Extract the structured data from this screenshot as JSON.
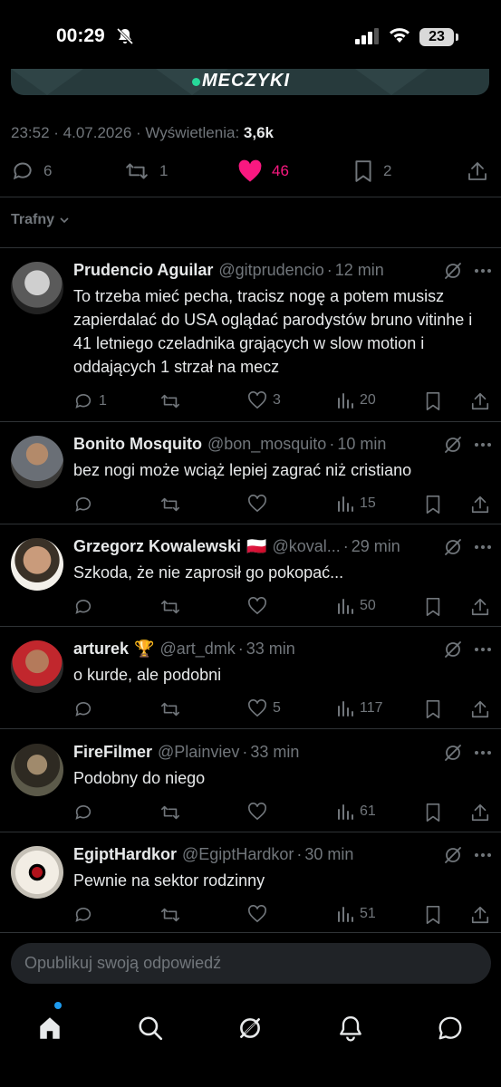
{
  "status": {
    "time": "00:29",
    "battery": "23"
  },
  "media": {
    "logo_text": "MECZYKI",
    "accent_color": "#27d99a"
  },
  "tweet": {
    "time": "23:52",
    "date": "4.07.2026",
    "views_label": "Wyświetlenia:",
    "views": "3,6k",
    "replies": "6",
    "reposts": "1",
    "likes": "46",
    "bookmarks": "2",
    "like_color": "#f91880"
  },
  "sort_label": "Trafny",
  "replies": [
    {
      "name": "Prudencio Aguilar",
      "handle": "@gitprudencio",
      "time": "12 min",
      "text": "To trzeba mieć pecha, tracisz nogę a potem musisz zapierdalać do USA oglądać parodystów bruno vitinhe i 41 letniego czeladnika grających w slow motion i oddających 1 strzał na mecz",
      "replies": "1",
      "reposts": "",
      "likes": "3",
      "views": "20"
    },
    {
      "name": "Bonito Mosquito",
      "handle": "@bon_mosquito",
      "time": "10 min",
      "text": "bez nogi może wciąż lepiej zagrać niż cristiano",
      "replies": "",
      "reposts": "",
      "likes": "",
      "views": "15"
    },
    {
      "name": "Grzegorz Kowalewski",
      "badge": "🇵🇱",
      "handle": "@koval...",
      "time": "29 min",
      "text": "Szkoda, że nie zaprosił go pokopać...",
      "replies": "",
      "reposts": "",
      "likes": "",
      "views": "50"
    },
    {
      "name": "arturek",
      "badge": "🏆",
      "handle": "@art_dmk",
      "time": "33 min",
      "text": "o kurde, ale podobni",
      "replies": "",
      "reposts": "",
      "likes": "5",
      "views": "117"
    },
    {
      "name": "FireFilmer",
      "handle": "@Plainviev",
      "time": "33 min",
      "text": "Podobny do niego",
      "replies": "",
      "reposts": "",
      "likes": "",
      "views": "61"
    },
    {
      "name": "EgiptHardkor",
      "handle": "@EgiptHardkor",
      "time": "30 min",
      "text": "Pewnie na sektor rodzinny",
      "replies": "",
      "reposts": "",
      "likes": "",
      "views": "51"
    }
  ],
  "compose": {
    "placeholder": "Opublikuj swoją odpowiedź"
  },
  "tabs": [
    "home-icon",
    "search-icon",
    "grok-icon",
    "notifications-icon",
    "messages-icon"
  ]
}
